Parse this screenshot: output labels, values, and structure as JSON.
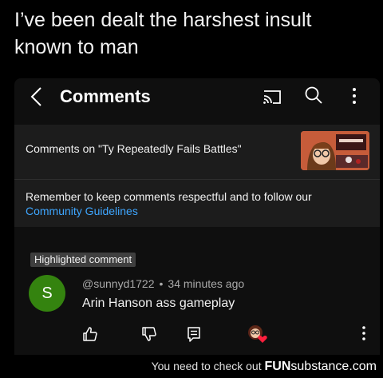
{
  "post": {
    "caption": "I’ve been dealt the harshest insult known to man"
  },
  "header": {
    "title": "Comments",
    "icons": [
      "back-arrow-icon",
      "cast-icon",
      "search-icon",
      "more-vertical-icon"
    ]
  },
  "video": {
    "label": "Comments on \"Ty Repeatedly Fails Battles\""
  },
  "notice": {
    "text": "Remember to keep comments respectful and to follow our",
    "link": "Community Guidelines"
  },
  "comment": {
    "badge": "Highlighted comment",
    "avatar_letter": "S",
    "avatar_color": "#34830f",
    "author": "@sunnyd1722",
    "time": "34 minutes ago",
    "text": "Arin Hanson ass gameplay",
    "actions": [
      "like-icon",
      "dislike-icon",
      "reply-icon",
      "creator-heart-icon",
      "more-vertical-icon"
    ]
  },
  "watermark": {
    "prefix": "You need to check out",
    "brand_fun": "FUN",
    "brand_rest": "substance.com"
  }
}
